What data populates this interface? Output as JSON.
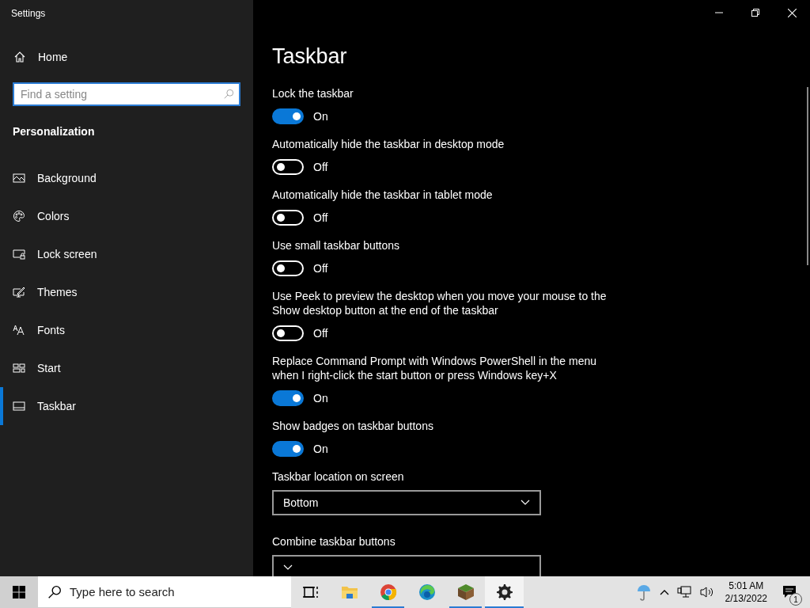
{
  "window": {
    "title": "Settings"
  },
  "sidebar": {
    "home": "Home",
    "search": {
      "placeholder": "Find a setting"
    },
    "section": "Personalization",
    "items": [
      {
        "label": "Background",
        "selected": false
      },
      {
        "label": "Colors",
        "selected": false
      },
      {
        "label": "Lock screen",
        "selected": false
      },
      {
        "label": "Themes",
        "selected": false
      },
      {
        "label": "Fonts",
        "selected": false
      },
      {
        "label": "Start",
        "selected": false
      },
      {
        "label": "Taskbar",
        "selected": true
      }
    ]
  },
  "page": {
    "title": "Taskbar",
    "settings": [
      {
        "kind": "toggle",
        "label": "Lock the taskbar",
        "on": true,
        "state": "On"
      },
      {
        "kind": "toggle",
        "label": "Automatically hide the taskbar in desktop mode",
        "on": false,
        "state": "Off"
      },
      {
        "kind": "toggle",
        "label": "Automatically hide the taskbar in tablet mode",
        "on": false,
        "state": "Off"
      },
      {
        "kind": "toggle",
        "label": "Use small taskbar buttons",
        "on": false,
        "state": "Off"
      },
      {
        "kind": "toggle",
        "label": "Use Peek to preview the desktop when you move your mouse to the Show desktop button at the end of the taskbar",
        "on": false,
        "state": "Off"
      },
      {
        "kind": "toggle",
        "label": "Replace Command Prompt with Windows PowerShell in the menu when I right-click the start button or press Windows key+X",
        "on": true,
        "state": "On"
      },
      {
        "kind": "toggle",
        "label": "Show badges on taskbar buttons",
        "on": true,
        "state": "On"
      },
      {
        "kind": "dropdown",
        "label": "Taskbar location on screen",
        "value": "Bottom"
      },
      {
        "kind": "dropdown",
        "label": "Combine taskbar buttons"
      }
    ]
  },
  "taskbar": {
    "search": {
      "placeholder": "Type here to search"
    },
    "apps": [
      {
        "running": false,
        "selected": false
      },
      {
        "running": false,
        "selected": false
      },
      {
        "running": true,
        "selected": false
      },
      {
        "running": false,
        "selected": false
      },
      {
        "running": true,
        "selected": false
      },
      {
        "running": true,
        "selected": true
      }
    ],
    "time": "5:01 AM",
    "date": "2/13/2022",
    "notifications": "1"
  }
}
